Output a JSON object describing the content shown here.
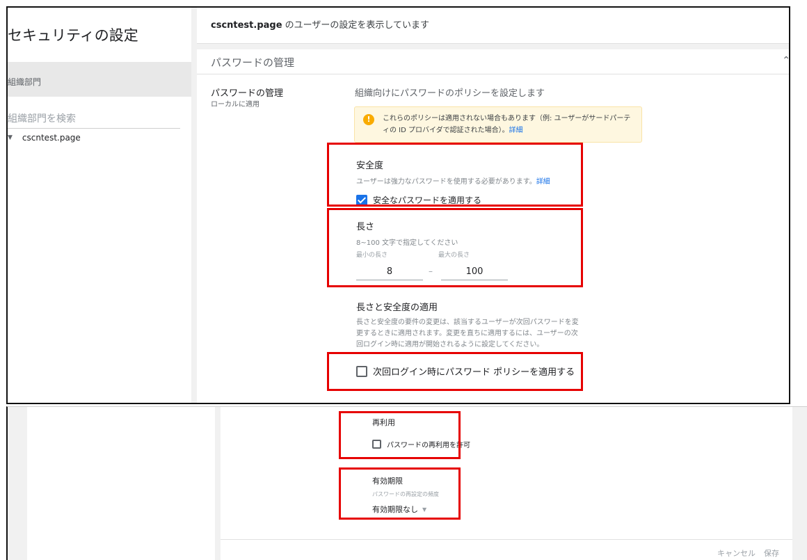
{
  "sidebar": {
    "title": "セキュリティの設定",
    "org_section_label": "組織部門",
    "search_placeholder": "組織部門を検索",
    "tree": [
      {
        "label": "cscntest.page"
      }
    ]
  },
  "header": {
    "domain": "cscntest.page",
    "text": " のユーザーの設定を表示しています"
  },
  "card": {
    "title": "パスワードの管理",
    "setting_name": "パスワードの管理",
    "setting_scope": "ローカルに適用",
    "setting_description": "組織向けにパスワードのポリシーを設定します",
    "notice": {
      "text": "これらのポリシーは適用されない場合もあります（例: ユーザーがサードパーティの ID プロバイダで認証された場合）。",
      "link": "詳細"
    },
    "strength": {
      "title": "安全度",
      "description": "ユーザーは強力なパスワードを使用する必要があります。",
      "link": "詳細",
      "checkbox_label": "安全なパスワードを適用する",
      "checked": true
    },
    "length": {
      "title": "長さ",
      "description": "8~100 文字で指定してください",
      "min_label": "最小の長さ",
      "max_label": "最大の長さ",
      "min_value": "8",
      "max_value": "100",
      "separator": "–"
    },
    "enforce": {
      "title": "長さと安全度の適用",
      "description": "長さと安全度の要件の変更は、該当するユーザーが次回パスワードを変更するときに適用されます。変更を直ちに適用するには、ユーザーの次回ログイン時に適用が開始されるように設定してください。",
      "checkbox_label": "次回ログイン時にパスワード ポリシーを適用する",
      "checked": false
    },
    "reuse": {
      "title": "再利用",
      "checkbox_label": "パスワードの再利用を許可",
      "checked": false
    },
    "expiration": {
      "title": "有効期限",
      "description": "パスワードの再設定の頻度",
      "selected": "有効期限なし"
    },
    "footer": {
      "cancel": "キャンセル",
      "save": "保存"
    }
  },
  "colors": {
    "accent": "#1a73e8",
    "highlight_box": "#e60000",
    "notice_bg": "#fef7e0",
    "notice_icon": "#f9ab00"
  },
  "icons": [
    "info-icon",
    "caret-down-icon",
    "collapse-chevron-icon",
    "dropdown-arrow-icon"
  ]
}
